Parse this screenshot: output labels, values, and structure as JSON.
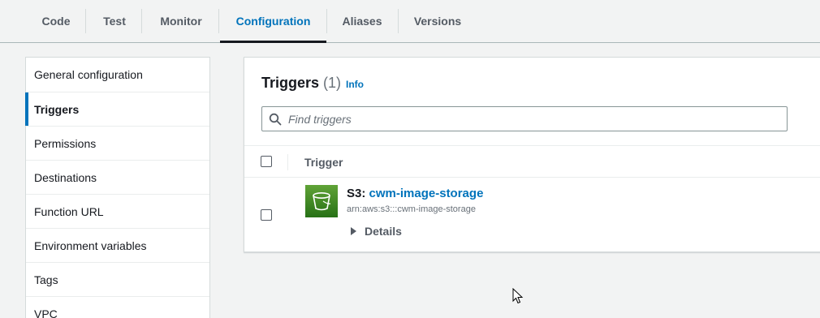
{
  "tabs": [
    {
      "label": "Code"
    },
    {
      "label": "Test"
    },
    {
      "label": "Monitor"
    },
    {
      "label": "Configuration",
      "active": true
    },
    {
      "label": "Aliases"
    },
    {
      "label": "Versions"
    }
  ],
  "sidenav": {
    "items": [
      {
        "label": "General configuration"
      },
      {
        "label": "Triggers",
        "active": true
      },
      {
        "label": "Permissions"
      },
      {
        "label": "Destinations"
      },
      {
        "label": "Function URL"
      },
      {
        "label": "Environment variables"
      },
      {
        "label": "Tags"
      },
      {
        "label": "VPC"
      }
    ]
  },
  "triggers": {
    "title": "Triggers",
    "count": "(1)",
    "info_label": "Info",
    "search_placeholder": "Find triggers",
    "column_header": "Trigger",
    "rows": [
      {
        "service": "S3",
        "separator": ": ",
        "name": "cwm-image-storage",
        "arn": "arn:aws:s3:::cwm-image-storage",
        "details_label": "Details",
        "icon": "s3-bucket-icon"
      }
    ]
  },
  "colors": {
    "accent": "#0073bb",
    "s3_icon": "#3f8624",
    "background": "#f2f3f3"
  }
}
